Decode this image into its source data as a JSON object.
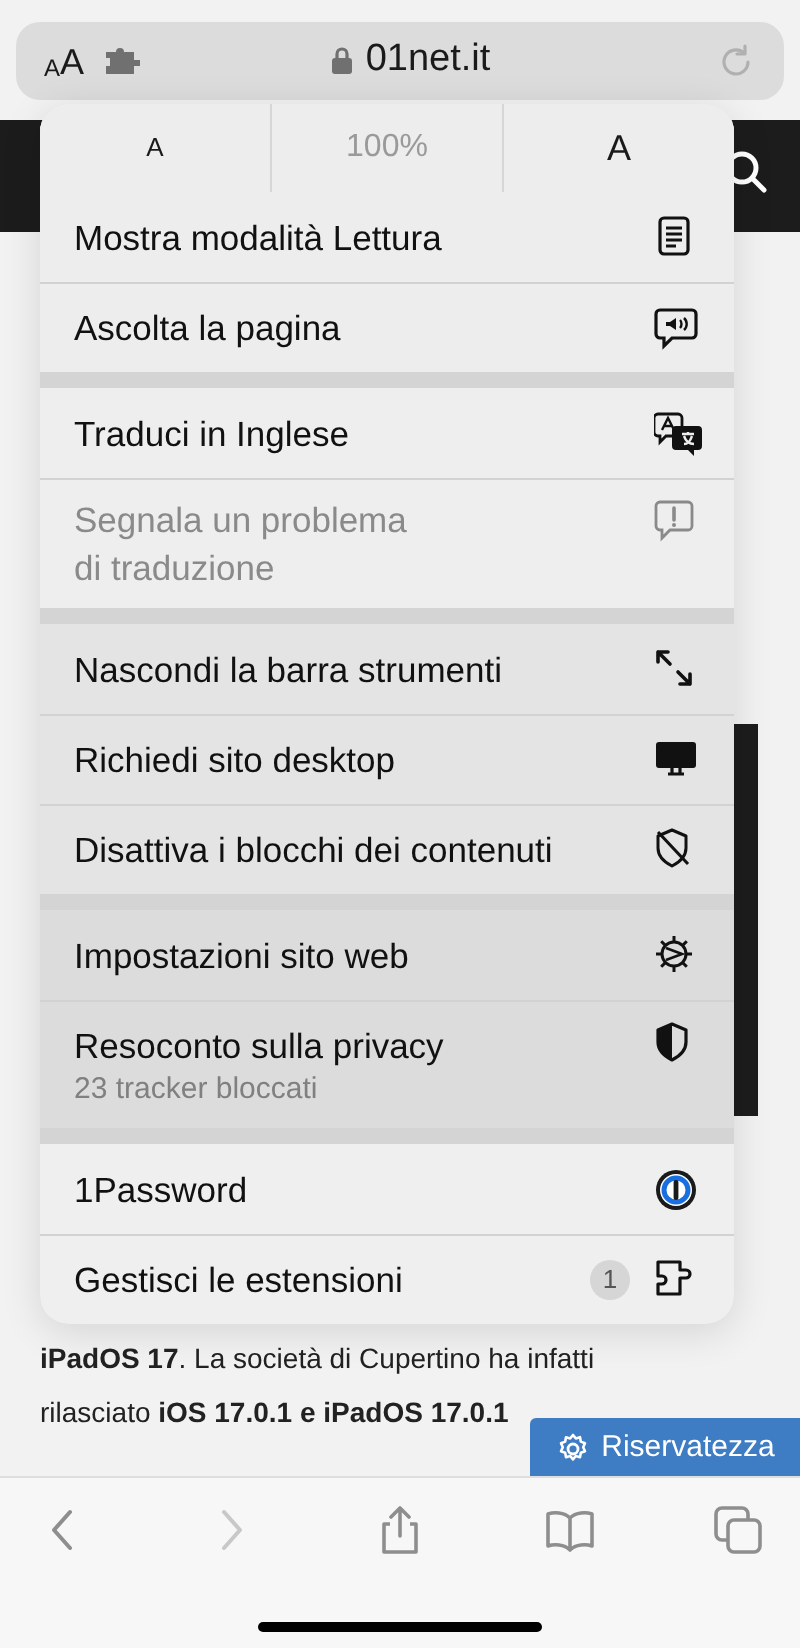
{
  "address_bar": {
    "text_size_button": {
      "small": "A",
      "large": "A"
    },
    "url": "01net.it"
  },
  "menu": {
    "zoom": {
      "decrease": "A",
      "level": "100%",
      "increase": "A"
    },
    "groups": [
      [
        {
          "label": "Mostra modalità Lettura",
          "disabled": false
        },
        {
          "label": "Ascolta la pagina",
          "disabled": false
        }
      ],
      [
        {
          "label": "Traduci in Inglese",
          "disabled": false
        },
        {
          "label": "Segnala un problema\ndi traduzione",
          "disabled": true
        }
      ],
      [
        {
          "label": "Nascondi la barra strumenti",
          "disabled": false
        },
        {
          "label": "Richiedi sito desktop",
          "disabled": false
        },
        {
          "label": "Disattiva i blocchi dei contenuti",
          "disabled": false
        }
      ],
      [
        {
          "label": "Impostazioni sito web",
          "disabled": false
        },
        {
          "label": "Resoconto sulla privacy",
          "subtitle": "23 tracker bloccati",
          "disabled": false
        }
      ],
      [
        {
          "label": "1Password",
          "disabled": false
        },
        {
          "label": "Gestisci le estensioni",
          "badge": "1",
          "disabled": false
        }
      ]
    ]
  },
  "article": {
    "lines": [
      "**iPadOS 17**. La società di Cupertino ha infatti",
      "rilasciato **iOS 17.0.1 e iPadOS 17.0.1**"
    ]
  },
  "privacy_button": {
    "label": "Riservatezza"
  },
  "toolbar": {
    "buttons": [
      {
        "kind": "back",
        "disabled": false
      },
      {
        "kind": "forward",
        "disabled": true
      },
      {
        "kind": "share",
        "disabled": false
      },
      {
        "kind": "bookmarks",
        "disabled": false
      },
      {
        "kind": "tabs",
        "disabled": false
      }
    ]
  }
}
